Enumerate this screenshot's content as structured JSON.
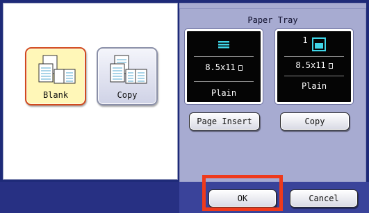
{
  "options": [
    {
      "label": "Blank",
      "selected": true
    },
    {
      "label": "Copy",
      "selected": false
    }
  ],
  "paper_tray": {
    "heading": "Paper Tray",
    "trays": [
      {
        "tray_number": "",
        "size": "8.5x11",
        "type": "Plain"
      },
      {
        "tray_number": "1",
        "size": "8.5x11",
        "type": "Plain"
      }
    ],
    "page_insert_label": "Page Insert",
    "copy_label": "Copy"
  },
  "footer": {
    "ok_label": "OK",
    "cancel_label": "Cancel"
  },
  "colors": {
    "screen_bg": "#1e2a78",
    "tray_panel": "#a7abd1",
    "selected_fill": "#fff7b8",
    "selected_border": "#d24a1e",
    "highlight": "#ee3a1c",
    "tray_icon": "#3fd6e8"
  }
}
